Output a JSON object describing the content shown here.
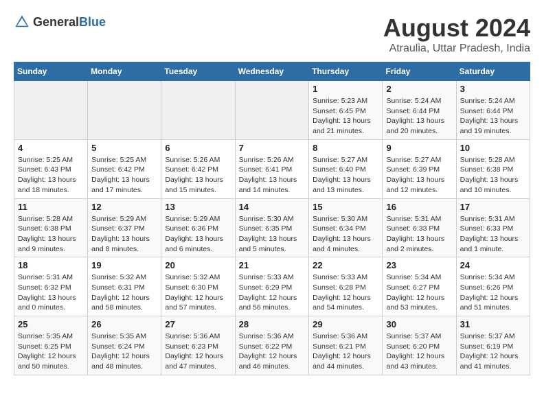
{
  "header": {
    "logo_general": "General",
    "logo_blue": "Blue",
    "month_year": "August 2024",
    "location": "Atraulia, Uttar Pradesh, India"
  },
  "days_of_week": [
    "Sunday",
    "Monday",
    "Tuesday",
    "Wednesday",
    "Thursday",
    "Friday",
    "Saturday"
  ],
  "weeks": [
    [
      {
        "day": "",
        "sunrise": "",
        "sunset": "",
        "daylight": "",
        "empty": true
      },
      {
        "day": "",
        "sunrise": "",
        "sunset": "",
        "daylight": "",
        "empty": true
      },
      {
        "day": "",
        "sunrise": "",
        "sunset": "",
        "daylight": "",
        "empty": true
      },
      {
        "day": "",
        "sunrise": "",
        "sunset": "",
        "daylight": "",
        "empty": true
      },
      {
        "day": "1",
        "sunrise": "Sunrise: 5:23 AM",
        "sunset": "Sunset: 6:45 PM",
        "daylight": "Daylight: 13 hours and 21 minutes.",
        "empty": false
      },
      {
        "day": "2",
        "sunrise": "Sunrise: 5:24 AM",
        "sunset": "Sunset: 6:44 PM",
        "daylight": "Daylight: 13 hours and 20 minutes.",
        "empty": false
      },
      {
        "day": "3",
        "sunrise": "Sunrise: 5:24 AM",
        "sunset": "Sunset: 6:44 PM",
        "daylight": "Daylight: 13 hours and 19 minutes.",
        "empty": false
      }
    ],
    [
      {
        "day": "4",
        "sunrise": "Sunrise: 5:25 AM",
        "sunset": "Sunset: 6:43 PM",
        "daylight": "Daylight: 13 hours and 18 minutes.",
        "empty": false
      },
      {
        "day": "5",
        "sunrise": "Sunrise: 5:25 AM",
        "sunset": "Sunset: 6:42 PM",
        "daylight": "Daylight: 13 hours and 17 minutes.",
        "empty": false
      },
      {
        "day": "6",
        "sunrise": "Sunrise: 5:26 AM",
        "sunset": "Sunset: 6:42 PM",
        "daylight": "Daylight: 13 hours and 15 minutes.",
        "empty": false
      },
      {
        "day": "7",
        "sunrise": "Sunrise: 5:26 AM",
        "sunset": "Sunset: 6:41 PM",
        "daylight": "Daylight: 13 hours and 14 minutes.",
        "empty": false
      },
      {
        "day": "8",
        "sunrise": "Sunrise: 5:27 AM",
        "sunset": "Sunset: 6:40 PM",
        "daylight": "Daylight: 13 hours and 13 minutes.",
        "empty": false
      },
      {
        "day": "9",
        "sunrise": "Sunrise: 5:27 AM",
        "sunset": "Sunset: 6:39 PM",
        "daylight": "Daylight: 13 hours and 12 minutes.",
        "empty": false
      },
      {
        "day": "10",
        "sunrise": "Sunrise: 5:28 AM",
        "sunset": "Sunset: 6:38 PM",
        "daylight": "Daylight: 13 hours and 10 minutes.",
        "empty": false
      }
    ],
    [
      {
        "day": "11",
        "sunrise": "Sunrise: 5:28 AM",
        "sunset": "Sunset: 6:38 PM",
        "daylight": "Daylight: 13 hours and 9 minutes.",
        "empty": false
      },
      {
        "day": "12",
        "sunrise": "Sunrise: 5:29 AM",
        "sunset": "Sunset: 6:37 PM",
        "daylight": "Daylight: 13 hours and 8 minutes.",
        "empty": false
      },
      {
        "day": "13",
        "sunrise": "Sunrise: 5:29 AM",
        "sunset": "Sunset: 6:36 PM",
        "daylight": "Daylight: 13 hours and 6 minutes.",
        "empty": false
      },
      {
        "day": "14",
        "sunrise": "Sunrise: 5:30 AM",
        "sunset": "Sunset: 6:35 PM",
        "daylight": "Daylight: 13 hours and 5 minutes.",
        "empty": false
      },
      {
        "day": "15",
        "sunrise": "Sunrise: 5:30 AM",
        "sunset": "Sunset: 6:34 PM",
        "daylight": "Daylight: 13 hours and 4 minutes.",
        "empty": false
      },
      {
        "day": "16",
        "sunrise": "Sunrise: 5:31 AM",
        "sunset": "Sunset: 6:33 PM",
        "daylight": "Daylight: 13 hours and 2 minutes.",
        "empty": false
      },
      {
        "day": "17",
        "sunrise": "Sunrise: 5:31 AM",
        "sunset": "Sunset: 6:33 PM",
        "daylight": "Daylight: 13 hours and 1 minute.",
        "empty": false
      }
    ],
    [
      {
        "day": "18",
        "sunrise": "Sunrise: 5:31 AM",
        "sunset": "Sunset: 6:32 PM",
        "daylight": "Daylight: 13 hours and 0 minutes.",
        "empty": false
      },
      {
        "day": "19",
        "sunrise": "Sunrise: 5:32 AM",
        "sunset": "Sunset: 6:31 PM",
        "daylight": "Daylight: 12 hours and 58 minutes.",
        "empty": false
      },
      {
        "day": "20",
        "sunrise": "Sunrise: 5:32 AM",
        "sunset": "Sunset: 6:30 PM",
        "daylight": "Daylight: 12 hours and 57 minutes.",
        "empty": false
      },
      {
        "day": "21",
        "sunrise": "Sunrise: 5:33 AM",
        "sunset": "Sunset: 6:29 PM",
        "daylight": "Daylight: 12 hours and 56 minutes.",
        "empty": false
      },
      {
        "day": "22",
        "sunrise": "Sunrise: 5:33 AM",
        "sunset": "Sunset: 6:28 PM",
        "daylight": "Daylight: 12 hours and 54 minutes.",
        "empty": false
      },
      {
        "day": "23",
        "sunrise": "Sunrise: 5:34 AM",
        "sunset": "Sunset: 6:27 PM",
        "daylight": "Daylight: 12 hours and 53 minutes.",
        "empty": false
      },
      {
        "day": "24",
        "sunrise": "Sunrise: 5:34 AM",
        "sunset": "Sunset: 6:26 PM",
        "daylight": "Daylight: 12 hours and 51 minutes.",
        "empty": false
      }
    ],
    [
      {
        "day": "25",
        "sunrise": "Sunrise: 5:35 AM",
        "sunset": "Sunset: 6:25 PM",
        "daylight": "Daylight: 12 hours and 50 minutes.",
        "empty": false
      },
      {
        "day": "26",
        "sunrise": "Sunrise: 5:35 AM",
        "sunset": "Sunset: 6:24 PM",
        "daylight": "Daylight: 12 hours and 48 minutes.",
        "empty": false
      },
      {
        "day": "27",
        "sunrise": "Sunrise: 5:36 AM",
        "sunset": "Sunset: 6:23 PM",
        "daylight": "Daylight: 12 hours and 47 minutes.",
        "empty": false
      },
      {
        "day": "28",
        "sunrise": "Sunrise: 5:36 AM",
        "sunset": "Sunset: 6:22 PM",
        "daylight": "Daylight: 12 hours and 46 minutes.",
        "empty": false
      },
      {
        "day": "29",
        "sunrise": "Sunrise: 5:36 AM",
        "sunset": "Sunset: 6:21 PM",
        "daylight": "Daylight: 12 hours and 44 minutes.",
        "empty": false
      },
      {
        "day": "30",
        "sunrise": "Sunrise: 5:37 AM",
        "sunset": "Sunset: 6:20 PM",
        "daylight": "Daylight: 12 hours and 43 minutes.",
        "empty": false
      },
      {
        "day": "31",
        "sunrise": "Sunrise: 5:37 AM",
        "sunset": "Sunset: 6:19 PM",
        "daylight": "Daylight: 12 hours and 41 minutes.",
        "empty": false
      }
    ]
  ]
}
